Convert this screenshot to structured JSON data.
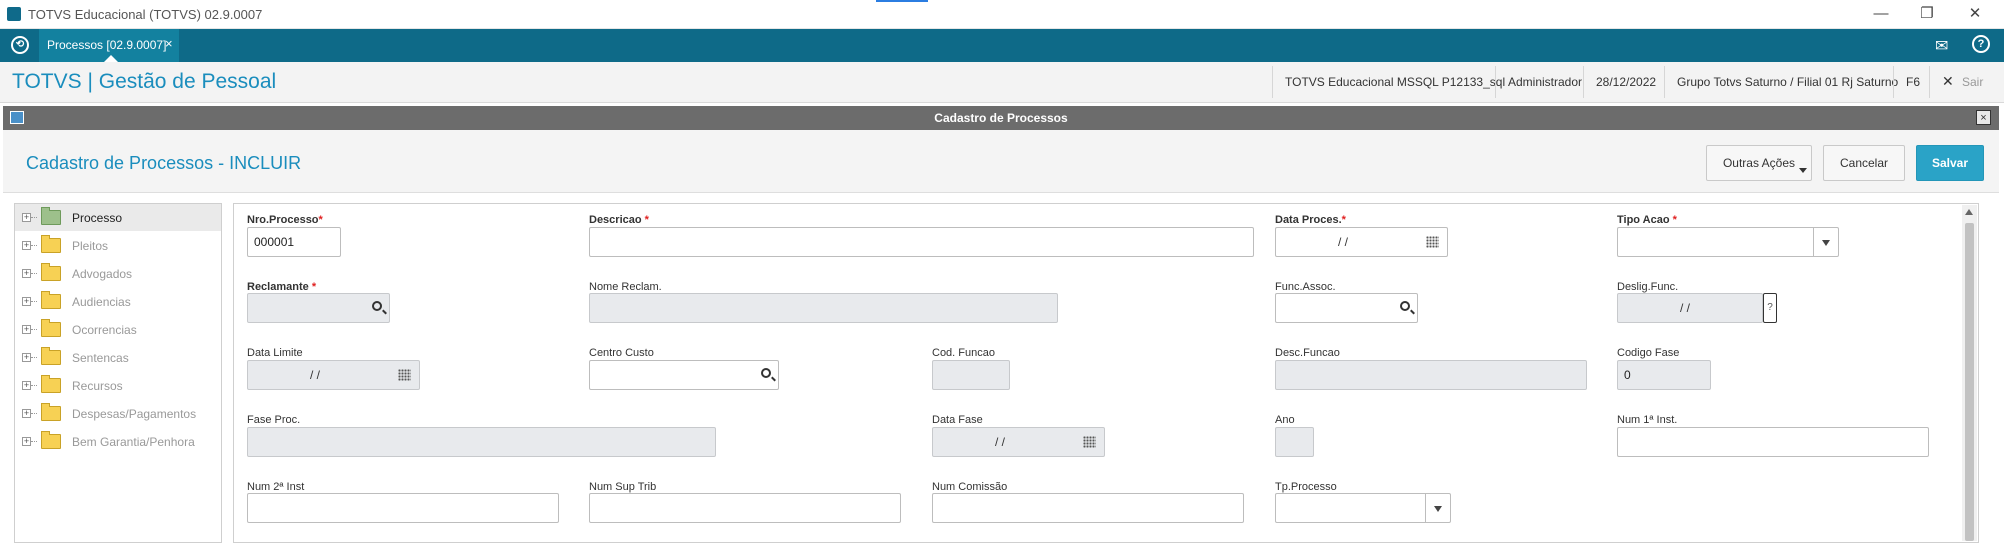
{
  "window": {
    "title": "TOTVS Educacional (TOTVS) 02.9.0007",
    "minimize": "—",
    "restore": "❐",
    "close": "✕"
  },
  "tabbar": {
    "tab_label": "Processos [02.9.0007]",
    "tab_close": "×",
    "mail_icon": "mail-icon",
    "help_icon": "help-icon",
    "help_glyph": "?",
    "mail_glyph": "✉"
  },
  "header": {
    "brand": "TOTVS | Gestão de Pessoal",
    "environment": "TOTVS Educacional MSSQL P12133_sql",
    "user": "Administrador",
    "date": "28/12/2022",
    "branch": "Grupo Totvs Saturno / Filial 01 Rj Saturno",
    "key": "F6",
    "exit_label": "Sair",
    "exit_glyph": "✕"
  },
  "dialog": {
    "title": "Cadastro de Processos",
    "close_glyph": "×"
  },
  "form": {
    "title": "Cadastro de Processos - INCLUIR",
    "other_actions": "Outras Ações",
    "cancel": "Cancelar",
    "save": "Salvar"
  },
  "tree": {
    "items": [
      {
        "label": "Processo"
      },
      {
        "label": "Pleitos"
      },
      {
        "label": "Advogados"
      },
      {
        "label": "Audiencias"
      },
      {
        "label": "Ocorrencias"
      },
      {
        "label": "Sentencas"
      },
      {
        "label": "Recursos"
      },
      {
        "label": "Despesas/Pagamentos"
      },
      {
        "label": "Bem Garantia/Penhora"
      }
    ],
    "plus_glyph": "+"
  },
  "fields": {
    "nro_processo": {
      "label": "Nro.Processo",
      "required": "*",
      "value": "000001"
    },
    "descricao": {
      "label": "Descricao",
      "required": "*",
      "value": ""
    },
    "data_proces": {
      "label": "Data Proces.",
      "required": "*",
      "value": "/ /"
    },
    "tipo_acao": {
      "label": "Tipo Acao",
      "required": "*",
      "value": ""
    },
    "reclamante": {
      "label": "Reclamante",
      "required": "*",
      "value": ""
    },
    "nome_reclam": {
      "label": "Nome Reclam.",
      "value": ""
    },
    "func_assoc": {
      "label": "Func.Assoc.",
      "value": ""
    },
    "deslig_func": {
      "label": "Deslig.Func.",
      "value": "/ /",
      "help": "?"
    },
    "data_limite": {
      "label": "Data Limite",
      "value": "/ /"
    },
    "centro_custo": {
      "label": "Centro Custo",
      "value": ""
    },
    "cod_funcao": {
      "label": "Cod. Funcao",
      "value": ""
    },
    "desc_funcao": {
      "label": "Desc.Funcao",
      "value": ""
    },
    "codigo_fase": {
      "label": "Codigo Fase",
      "value": "0"
    },
    "fase_proc": {
      "label": "Fase Proc.",
      "value": ""
    },
    "data_fase": {
      "label": "Data Fase",
      "value": "/ /"
    },
    "ano": {
      "label": "Ano",
      "value": ""
    },
    "num_1_inst": {
      "label": "Num 1ª Inst.",
      "value": ""
    },
    "num_2_inst": {
      "label": "Num 2ª Inst",
      "value": ""
    },
    "num_sup_trib": {
      "label": "Num Sup Trib",
      "value": ""
    },
    "num_comissao": {
      "label": "Num Comissão",
      "value": ""
    },
    "tp_processo": {
      "label": "Tp.Processo",
      "value": ""
    }
  }
}
